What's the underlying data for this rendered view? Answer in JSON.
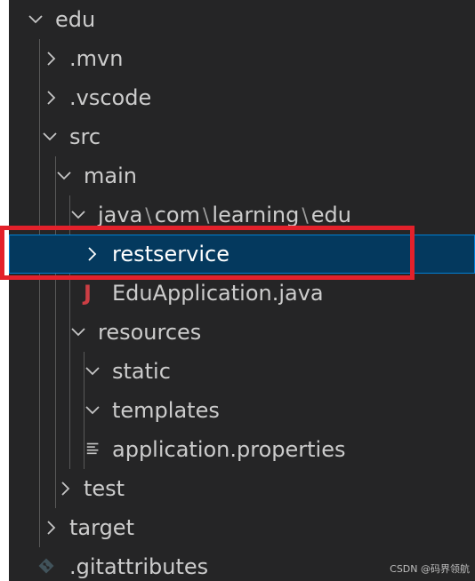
{
  "tree": {
    "root_folder": "edu",
    "mvn_folder": ".mvn",
    "vscode_folder": ".vscode",
    "src_folder": "src",
    "main_folder": "main",
    "java_path": {
      "seg1": "java",
      "seg2": "com",
      "seg3": "learning",
      "seg4": "edu",
      "separator": "\\"
    },
    "restservice_folder": "restservice",
    "edu_application_file": "EduApplication.java",
    "java_file_icon_letter": "J",
    "resources_folder": "resources",
    "static_folder": "static",
    "templates_folder": "templates",
    "properties_file": "application.properties",
    "test_folder": "test",
    "target_folder": "target",
    "gitattributes_file": ".gitattributes"
  },
  "selected_item": "restservice",
  "watermark": "CSDN @码界领航",
  "colors": {
    "sidebar_background": "#252526",
    "selection_background": "#04395e",
    "selection_border": "#007fd4",
    "highlight_box": "#e3212b",
    "java_icon": "#cc3e44",
    "text": "#cccccc"
  },
  "icons": {
    "collapsed": "chevron-right-icon",
    "expanded": "chevron-down-icon",
    "java_file": "java-file-icon",
    "properties_file": "lines-file-icon",
    "git_file": "git-icon"
  }
}
